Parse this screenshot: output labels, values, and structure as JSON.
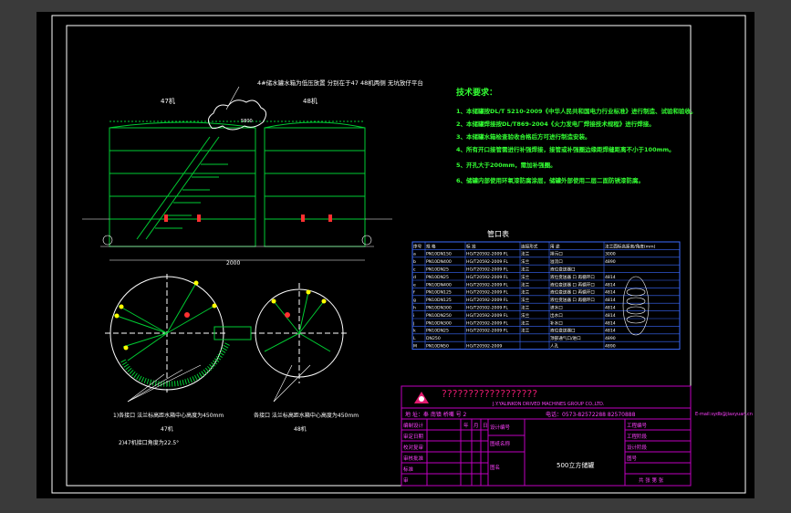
{
  "colors": {
    "viewport_bg": "#3a3a3a",
    "drawing_bg": "#000000",
    "frame": "#ffffff",
    "tank_lines": "#00cc33",
    "dim_lines": "#ffffff",
    "requirements_text": "#33ff33",
    "table_lines": "#3b6bff",
    "title_block_lines": "#c000c0",
    "title_block_text": "#ff40ff",
    "company_text": "#e01a6e",
    "accent_red": "#ff3030",
    "accent_yellow": "#ffff00"
  },
  "annotations": {
    "top_note": "4#储水罐水箱为低压放置 分别在于47 48机两侧 无坑放仔平台",
    "tank_label_left": "47机",
    "tank_label_right": "48机",
    "tank_dim_label": "5800",
    "bottom_dim": "2000",
    "plan_note_left": "1)各接口 法兰标高距水箱中心高度为450mm",
    "plan_note_left2": "2)47机接口角度为22.5°",
    "plan_note_right": "各接口 法兰标高距水箱中心高度为450mm",
    "plan_label_left": "47机",
    "plan_label_right": "48机"
  },
  "requirements": {
    "title": "技术要求：",
    "items": [
      "1、本储罐按DL/T 5210-2009《中华人民共和国电力行业标准》进行制造、试验和验收。",
      "2、本储罐焊接按DL/T869-2004《火力发电厂焊接技术规程》进行焊接。",
      "3、本储罐水箱检查验收合格后方可进行制造安装。",
      "4、所有开口接管需进行补强焊接，接管或补强圈边缘距焊缝距离不小于100mm。",
      "5、开孔大于200mm，需加补强圈。",
      "6、储罐内部使用环氧漆防腐涂层，储罐外部使用二层二面防锈漆防腐。"
    ]
  },
  "nozzle_table": {
    "title": "管口表",
    "headers": [
      "序号",
      "规 格",
      "标 准",
      "连接形式",
      "用 途",
      "法兰面标高距离/角度(mm)"
    ],
    "rows": [
      [
        "a",
        "PN10DN150",
        "HG/T20592-2009 FL",
        "法兰",
        "排污口",
        "3000"
      ],
      [
        "b",
        "PN10DN400",
        "HG/T20592-2009 FL",
        "法兰",
        "溢流口",
        "4890"
      ],
      [
        "c",
        "PN10DN25",
        "HG/T20592-2009 FL",
        "法兰",
        "液位变送器口",
        ""
      ],
      [
        "d",
        "PN10DN25",
        "HG/T20592-2009 FL",
        "法兰",
        "液位变送器 口 再循环口",
        "4814"
      ],
      [
        "e",
        "PN10DN400",
        "HG/T20592-2009 FL",
        "法兰",
        "液位变送器 口 再循环口",
        "4814"
      ],
      [
        "f",
        "PN10DN125",
        "HG/T20592-2009 FL",
        "法兰",
        "液位变送器 口 再循环口",
        "4814"
      ],
      [
        "g",
        "PN10DN125",
        "HG/T20592-2009 FL",
        "法兰",
        "液位变送器 口 再循环口",
        "4814"
      ],
      [
        "h",
        "PN10DN300",
        "HG/T20592-2009 FL",
        "法兰",
        "进水口",
        "4814"
      ],
      [
        "i",
        "PN10DN250",
        "HG/T20592-2009 FL",
        "法兰",
        "出水口",
        "4814"
      ],
      [
        "j",
        "PN10DN300",
        "HG/T20592-2009 FL",
        "法兰",
        "补水口",
        "4814"
      ],
      [
        "k",
        "PN10DN25",
        "HG/T20592-2009 FL",
        "法兰",
        "液位变送器口",
        "4814"
      ],
      [
        "L",
        "DN250",
        "",
        "",
        "顶部通气口/进口",
        "4890"
      ],
      [
        "M",
        "PN10DN50",
        "HG/T20592-2009",
        "",
        "人孔",
        "4890"
      ]
    ]
  },
  "title_block": {
    "company_cn": "??????????????????",
    "company_en": "J.Y.YALINKON DRIVED MACHINES GROUP CO.,LTD.",
    "address": "地 址：奉 南镇 桥嘴 号 2",
    "phone": "电话：0573-82572288 82570888",
    "email": "E-mail:sydb@jiaxyuan.cn",
    "drawing_name": "500立方储罐",
    "left_rows": [
      "编制设计",
      "审定日期",
      "校对复审",
      "审核批准",
      "标准",
      "审",
      "定"
    ],
    "date_units": [
      "年",
      "月",
      "日"
    ],
    "mid_labels": [
      "设计编号",
      "图纸名称",
      "图名"
    ],
    "right_labels": [
      "工程编号",
      "工程阶段",
      "设计阶段",
      "图号"
    ],
    "sheet_info": "共 张 第 张"
  }
}
